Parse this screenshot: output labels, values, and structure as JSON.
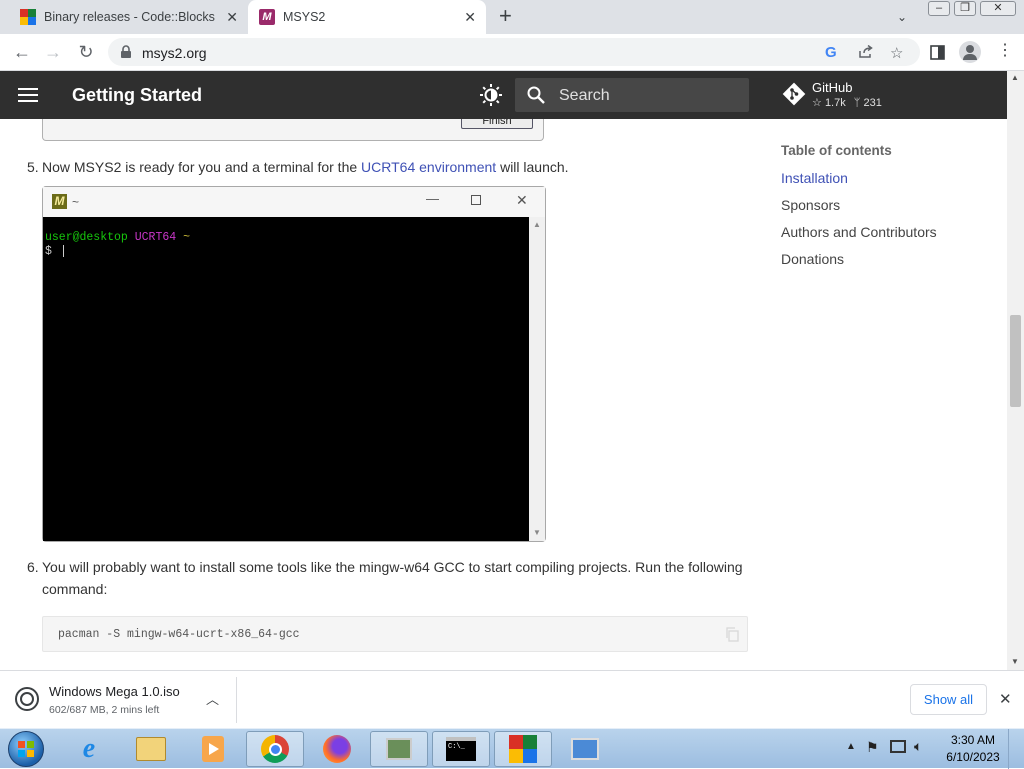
{
  "browser": {
    "tabs": [
      {
        "title": "Binary releases - Code::Blocks",
        "active": false
      },
      {
        "title": "MSYS2",
        "active": true
      }
    ],
    "url": "msys2.org"
  },
  "site": {
    "title": "Getting Started",
    "search_placeholder": "Search",
    "github": {
      "label": "GitHub",
      "stars": "1.7k",
      "forks": "231"
    }
  },
  "content": {
    "installer_button": "Finish",
    "step5": {
      "number": "5.",
      "text_before": "Now MSYS2 is ready for you and a terminal for the ",
      "link": "UCRT64 environment",
      "text_after": " will launch."
    },
    "terminal": {
      "title": "~",
      "prompt_user": "user@desktop",
      "prompt_env": "UCRT64",
      "prompt_dir": "~",
      "prompt_symbol": "$"
    },
    "step6": {
      "number": "6.",
      "text": "You will probably want to install some tools like the mingw-w64 GCC to start compiling projects. Run the following command:"
    },
    "code": "pacman -S mingw-w64-ucrt-x86_64-gcc"
  },
  "toc": {
    "title": "Table of contents",
    "items": [
      {
        "label": "Installation",
        "active": true
      },
      {
        "label": "Sponsors",
        "active": false
      },
      {
        "label": "Authors and Contributors",
        "active": false
      },
      {
        "label": "Donations",
        "active": false
      }
    ]
  },
  "download": {
    "filename": "Windows Mega 1.0.iso",
    "progress": "602/687 MB, 2 mins left",
    "show_all": "Show all"
  },
  "taskbar": {
    "time": "3:30 AM",
    "date": "6/10/2023"
  },
  "colors": {
    "header_bg": "#2f2f2f",
    "link": "#3f51b5",
    "term_user": "#16c60c",
    "term_env": "#c837c8"
  }
}
